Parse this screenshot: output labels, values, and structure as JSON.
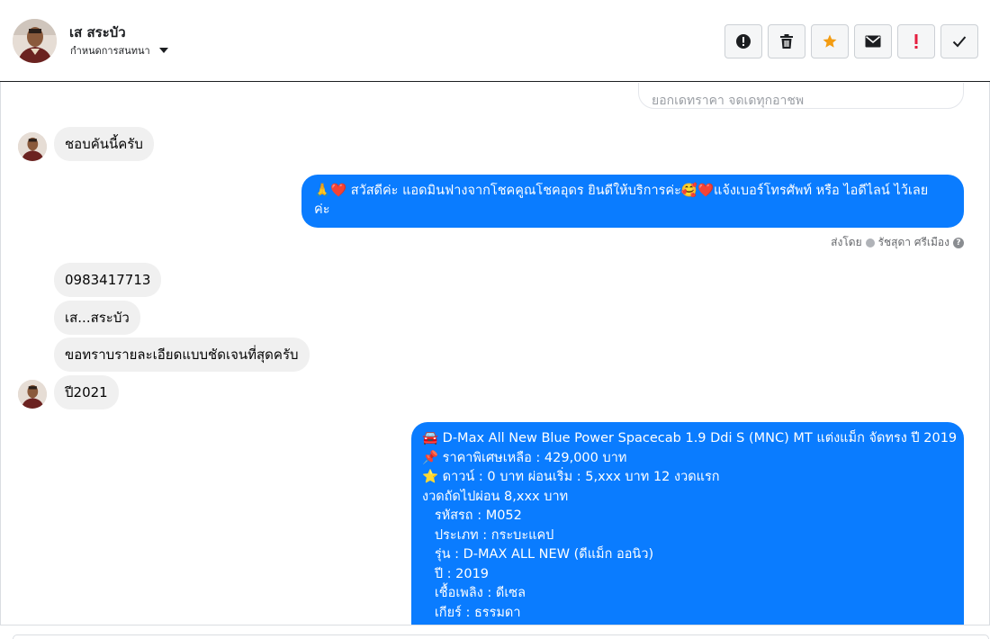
{
  "header": {
    "contact_name": "เส สระบัว",
    "assign_label": "กำหนดการสนทนา"
  },
  "toolbar": {
    "buttons": [
      {
        "icon": "alert-circle-icon"
      },
      {
        "icon": "trash-icon"
      },
      {
        "icon": "star-icon",
        "color": "#f39c12"
      },
      {
        "icon": "envelope-icon"
      },
      {
        "icon": "exclamation-icon",
        "color": "#e41e3f"
      },
      {
        "icon": "check-icon"
      }
    ]
  },
  "messages": {
    "prev_partial": "ยอกเดทราคา จดเดทุกอาชพ",
    "m1": "ชอบคันนี้ครับ",
    "m2_line1": "🙏❤️ สวัสดีค่ะ แอดมินฟางจากโชคคูณโชคอุดร ยินดีให้บริการค่ะ🥰❤️แจ้งเบอร์โทรศัพท์ หรือ ไอดีไลน์  ไว้เลย",
    "m2_line2": "ค่ะ",
    "sent_by_prefix": "ส่งโดย",
    "sent_by_name": "รัชสุดา ศรีเมือง",
    "m3": "0983417713",
    "m4": "เส...สระบัว",
    "m5": "ขอทราบรายละเอียดแบบชัดเจนที่สุดครับ",
    "m6": "ปี2021",
    "car": {
      "l1": "🚘 D-Max All New Blue Power Spacecab 1.9 Ddi S (MNC) MT แต่งแม็ก จัดทรง ปี 2019",
      "l2": "📌 ราคาพิเศษเหลือ : 429,000 บาท",
      "l3": "⭐ ดาวน์ : 0 บาท ผ่อนเริ่ม : 5,xxx บาท 12 งวดแรก",
      "l4": "งวดถัดไปผ่อน  8,xxx บาท",
      "l5": "   รหัสรถ : M052",
      "l6": "   ประเภท : กระบะแคป",
      "l7": "   รุ่น : D-MAX ALL NEW (ดีแม็ก ออนิว)",
      "l8": "   ปี : 2019",
      "l9": "   เชื้อเพลิง : ดีเซล",
      "l10": "   เกียร์ : ธรรมดา"
    }
  }
}
